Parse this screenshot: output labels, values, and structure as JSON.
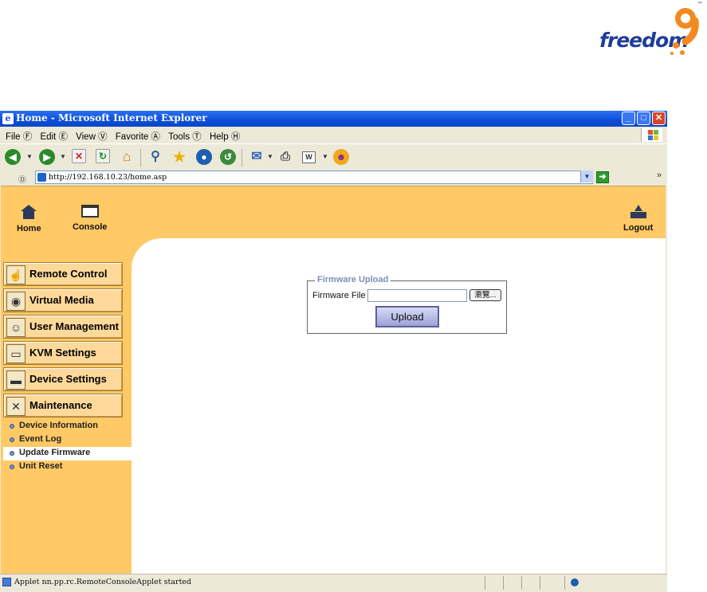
{
  "logo": {
    "text": "freedom",
    "tm": "™",
    "digit": "9",
    "colors": {
      "text": "#1e3d9a",
      "accent": "#f48a1f"
    }
  },
  "browser": {
    "title": "Home - Microsoft Internet Explorer",
    "menu": [
      "File Ⓕ",
      "Edit Ⓔ",
      "View Ⓥ",
      "Favorite Ⓐ",
      "Tools Ⓣ",
      "Help Ⓗ"
    ],
    "address": {
      "label": "Ⓓ",
      "url": "http://192.168.10.23/home.asp"
    },
    "status": "Applet nn.pp.rc.RemoteConsoleApplet started"
  },
  "topnav": {
    "home": "Home",
    "console": "Console",
    "logout": "Logout"
  },
  "sidebar": {
    "sections": [
      {
        "label": "Remote Control",
        "icon": "hand-icon"
      },
      {
        "label": "Virtual Media",
        "icon": "disc-icon"
      },
      {
        "label": "User Management",
        "icon": "users-icon"
      },
      {
        "label": "KVM Settings",
        "icon": "computer-icon"
      },
      {
        "label": "Device Settings",
        "icon": "device-icon"
      },
      {
        "label": "Maintenance",
        "icon": "tools-icon"
      }
    ],
    "subitems": [
      "Device Information",
      "Event Log",
      "Update Firmware",
      "Unit Reset"
    ],
    "active_subitem": "Update Firmware"
  },
  "firmware": {
    "legend": "Firmware Upload",
    "field_label": "Firmware File",
    "file_value": "",
    "browse_label": "瀏覽...",
    "upload_label": "Upload"
  }
}
